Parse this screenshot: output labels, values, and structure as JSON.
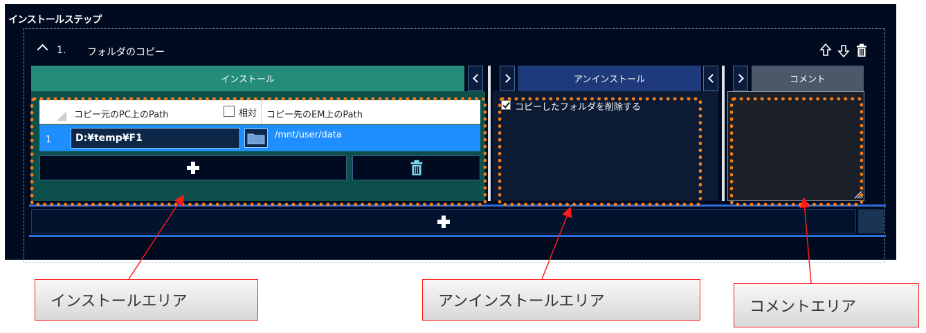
{
  "app_title": "インストールステップ",
  "step": {
    "number": "1.",
    "name": "フォルダのコピー"
  },
  "tabs": {
    "install": "インストール",
    "uninstall": "アンインストール",
    "comment": "コメント"
  },
  "install_table": {
    "headers": {
      "src": "コピー元のPC上のPath",
      "relative": "相対",
      "dst": "コピー先のEM上のPath"
    },
    "rows": [
      {
        "index": "1",
        "src": "D:¥temp¥F1",
        "dst": "/mnt/user/data"
      }
    ]
  },
  "uninstall": {
    "checkbox_label": "コピーしたフォルダを削除する",
    "checked": true
  },
  "callouts": {
    "install": "インストールエリア",
    "uninstall": "アンインストールエリア",
    "comment": "コメントエリア"
  },
  "colors": {
    "background": "#010b20",
    "install_tab": "#248c78",
    "install_body": "#0d4f4a",
    "uninstall_tab": "#1e3a7a",
    "comment_tab": "#4b586a",
    "highlight": "#f07d1e",
    "row_selected": "#1f8fff"
  }
}
